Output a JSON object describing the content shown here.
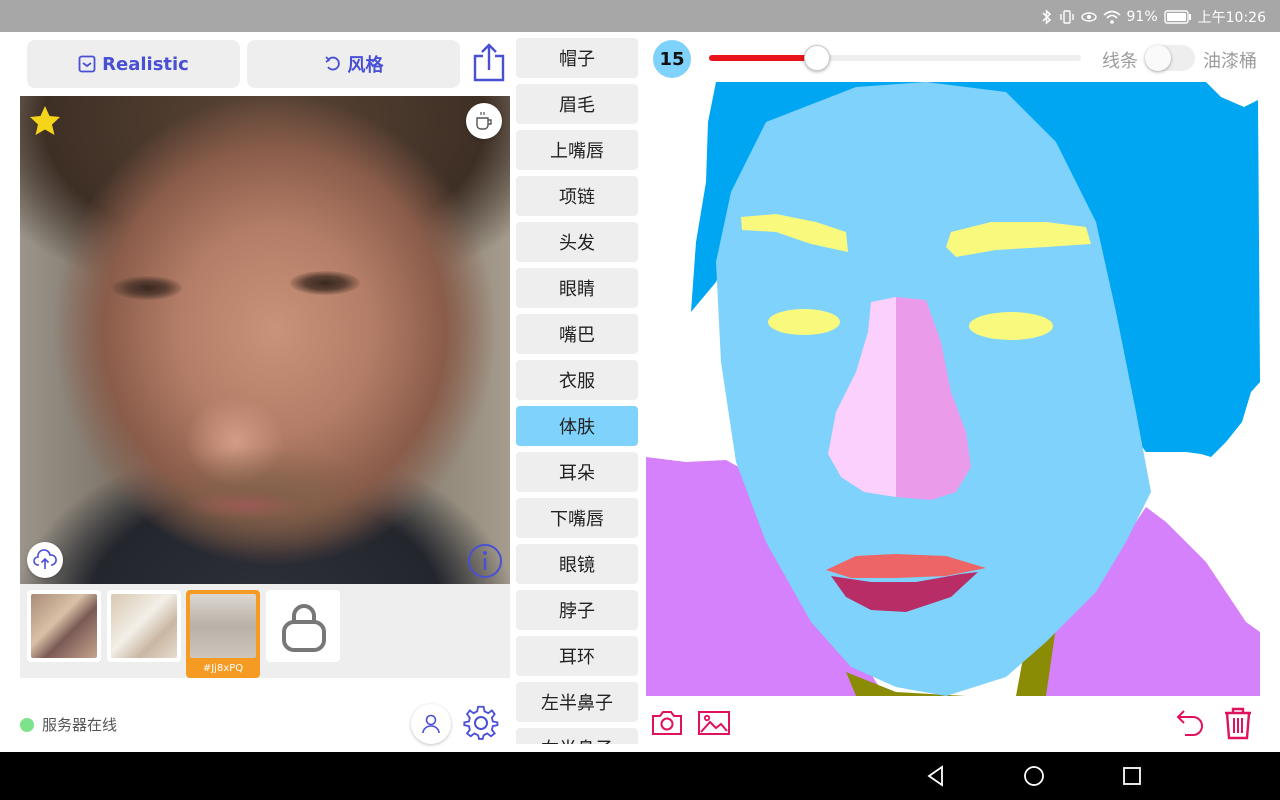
{
  "status_bar": {
    "battery": "91%",
    "time": "上午10:26"
  },
  "toolbar": {
    "realistic_label": "Realistic",
    "style_label": "风格"
  },
  "thumbnails": [
    {
      "id": "thumb-1",
      "tag": ""
    },
    {
      "id": "thumb-2",
      "tag": ""
    },
    {
      "id": "thumb-3",
      "tag": "#Jj8xPQ"
    }
  ],
  "server": {
    "status_text": "服务器在线",
    "status_color": "#7ee28a"
  },
  "parts": [
    {
      "label": "帽子"
    },
    {
      "label": "眉毛"
    },
    {
      "label": "上嘴唇"
    },
    {
      "label": "项链"
    },
    {
      "label": "头发"
    },
    {
      "label": "眼睛"
    },
    {
      "label": "嘴巴"
    },
    {
      "label": "衣服"
    },
    {
      "label": "体肤"
    },
    {
      "label": "耳朵"
    },
    {
      "label": "下嘴唇"
    },
    {
      "label": "眼镜"
    },
    {
      "label": "脖子"
    },
    {
      "label": "耳环"
    },
    {
      "label": "左半鼻子"
    },
    {
      "label": "右半鼻子"
    }
  ],
  "selected_part": "体肤",
  "brush": {
    "size": "15",
    "slider_fraction": 0.29,
    "slider_color": "#e8141a"
  },
  "draw_mode": {
    "line_label": "线条",
    "fill_label": "油漆桶",
    "fill_enabled": false
  },
  "segmentation_colors": {
    "hair": "#00a6f1",
    "skin": "#7fd2fb",
    "eyebrows": "#f9fa7d",
    "eyes": "#f9fa7d",
    "left_nose": "#fcd0fc",
    "right_nose": "#ea9cea",
    "upper_lip": "#ee6565",
    "lower_lip": "#b82d66",
    "clothes": "#d481fb",
    "neck": "#8b8c06"
  },
  "icons": {
    "realistic": "checkbox-square-icon",
    "style": "undo-arrow-icon",
    "share": "share-icon",
    "favorite": "star-icon",
    "coffee": "coffee-cup-icon",
    "upload": "cloud-upload-icon",
    "info": "info-icon",
    "lock": "lock-icon",
    "user": "user-icon",
    "settings": "gear-icon",
    "camera": "camera-icon",
    "gallery": "image-icon",
    "undo": "undo-icon",
    "delete": "trash-icon"
  },
  "accent": "#4a50d6",
  "danger": "#e0115f"
}
